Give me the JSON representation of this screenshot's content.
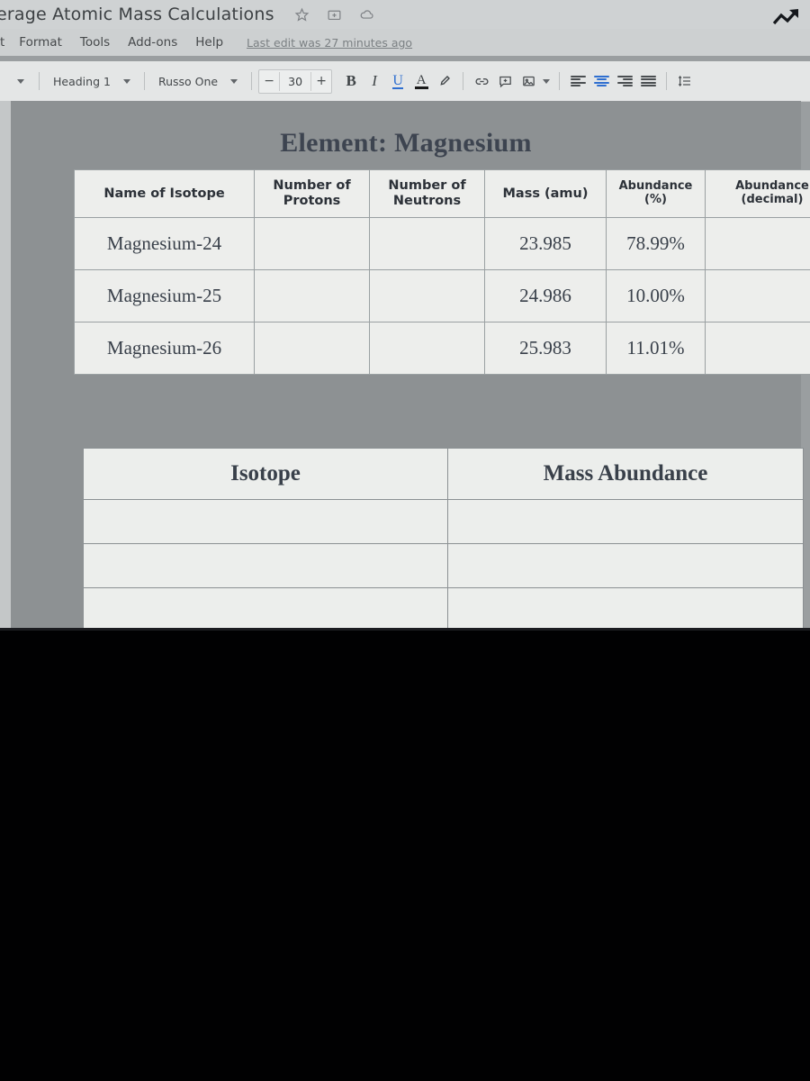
{
  "window": {
    "doc_title": "erage Atomic Mass Calculations",
    "icons": [
      "star-icon",
      "move-to-folder-icon",
      "cloud-saved-icon"
    ],
    "cursor": "zigzag-arrow-cursor"
  },
  "menu": {
    "items": [
      "t",
      "Format",
      "Tools",
      "Add-ons",
      "Help"
    ],
    "last_edit": "Last edit was 27 minutes ago"
  },
  "toolbar": {
    "undo_caret": "caret-down",
    "paragraph_style": "Heading 1",
    "font_family": "Russo One",
    "font_size": "30",
    "size_decrease": "−",
    "size_increase": "+",
    "bold": "B",
    "italic": "I",
    "underline": "U",
    "text_color": "A",
    "highlight": "highlighter-icon",
    "insert_link": "link-icon",
    "add_comment": "comment-icon",
    "insert_image": "image-icon",
    "align_left": "align-left-icon",
    "align_center": "align-center-icon",
    "align_right": "align-right-icon",
    "align_justify": "align-justify-icon",
    "line_spacing": "line-spacing-icon",
    "active_align": "center",
    "accent_color": "#2f6fd0"
  },
  "document": {
    "heading": "Element: Magnesium",
    "table_isotopes": {
      "headers": [
        "Name of Isotope",
        "Number of Protons",
        "Number of Neutrons",
        "Mass (amu)",
        "Abundance (%)",
        "Abundance (decimal)"
      ],
      "header_lines": [
        [
          "Name of Isotope"
        ],
        [
          "Number of",
          "Protons"
        ],
        [
          "Number of",
          "Neutrons"
        ],
        [
          "Mass (amu)"
        ],
        [
          "Abundance",
          "(%)"
        ],
        [
          "Abundance",
          "(decimal)"
        ]
      ],
      "rows": [
        {
          "name": "Magnesium-24",
          "protons": "",
          "neutrons": "",
          "mass": "23.985",
          "abundance_pct": "78.99%",
          "abundance_dec": ""
        },
        {
          "name": "Magnesium-25",
          "protons": "",
          "neutrons": "",
          "mass": "24.986",
          "abundance_pct": "10.00%",
          "abundance_dec": ""
        },
        {
          "name": "Magnesium-26",
          "protons": "",
          "neutrons": "",
          "mass": "25.983",
          "abundance_pct": "11.01%",
          "abundance_dec": ""
        }
      ]
    },
    "table_mass_abundance": {
      "headers": [
        "Isotope",
        "Mass Abundance"
      ],
      "rows": [
        {
          "isotope": "",
          "mass_abundance": ""
        },
        {
          "isotope": "",
          "mass_abundance": ""
        },
        {
          "isotope": "",
          "mass_abundance": ""
        }
      ]
    }
  },
  "shelf": {
    "chrome_app": "google-chrome-icon"
  }
}
